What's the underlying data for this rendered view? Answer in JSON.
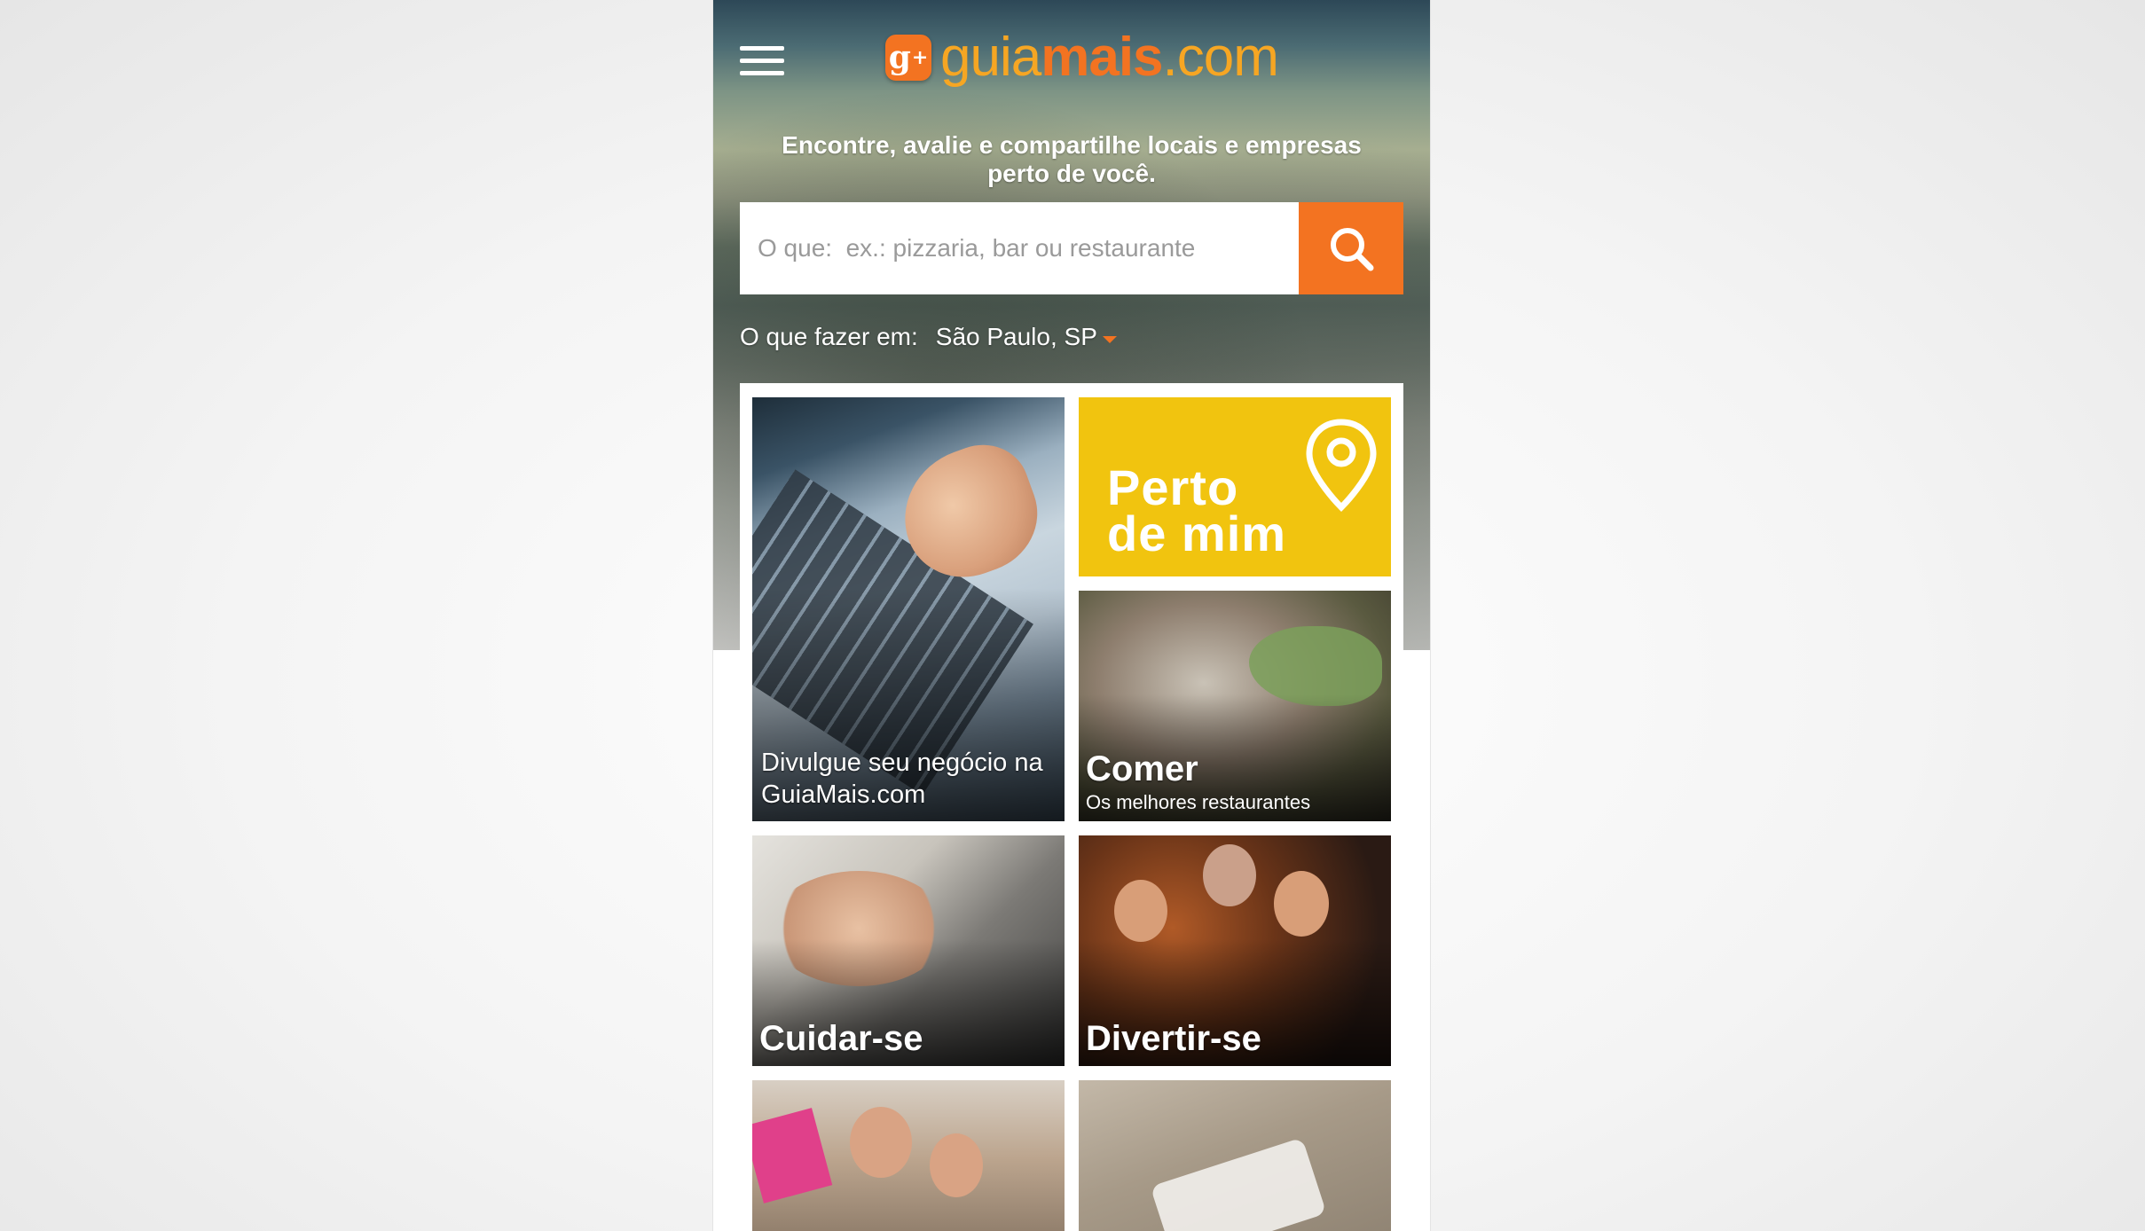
{
  "header": {
    "menu_icon": "hamburger-menu-icon",
    "logo": {
      "mark": "g",
      "mark_plus": "+",
      "guia": "guia",
      "mais": "mais",
      "com": ".com"
    },
    "tagline": "Encontre, avalie e compartilhe locais e empresas perto de você."
  },
  "search": {
    "placeholder": "O que:  ex.: pizzaria, bar ou restaurante",
    "value": "",
    "button_icon": "search-icon"
  },
  "location": {
    "label": "O que fazer em:",
    "value": "São Paulo, SP",
    "caret_icon": "caret-down-icon"
  },
  "tiles": {
    "divulgue": {
      "label": "Divulgue seu negócio na GuiaMais.com"
    },
    "perto": {
      "label": "Perto\nde mim",
      "icon": "map-pin-icon"
    },
    "comer": {
      "title": "Comer",
      "subtitle": "Os melhores restaurantes"
    },
    "cuidar": {
      "title": "Cuidar-se"
    },
    "divertir": {
      "title": "Divertir-se"
    }
  },
  "colors": {
    "accent_orange": "#f37321",
    "logo_yellow": "#f6a623",
    "perto_yellow": "#f1c40f"
  }
}
